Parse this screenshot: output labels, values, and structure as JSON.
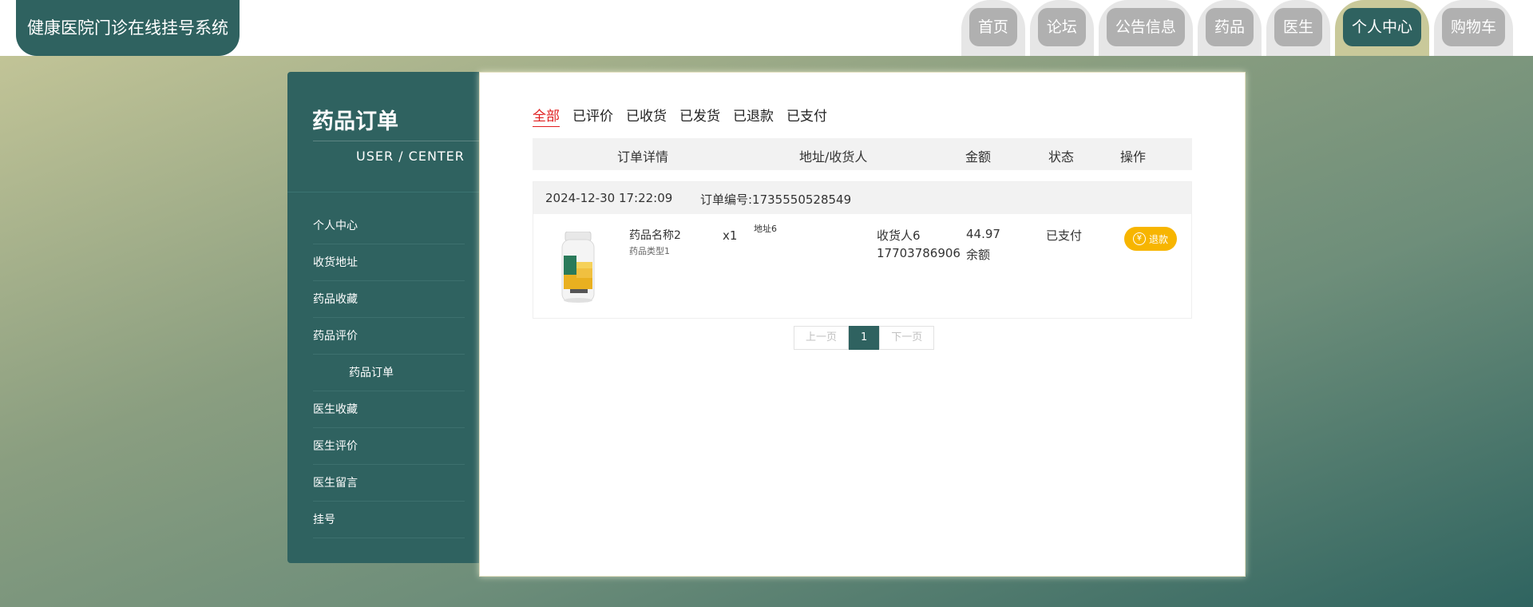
{
  "app": {
    "title": "健康医院门诊在线挂号系统"
  },
  "nav": {
    "items": [
      {
        "label": "首页"
      },
      {
        "label": "论坛"
      },
      {
        "label": "公告信息"
      },
      {
        "label": "药品"
      },
      {
        "label": "医生"
      },
      {
        "label": "个人中心",
        "active": true
      },
      {
        "label": "购物车"
      }
    ]
  },
  "sidebar": {
    "title": "药品订单",
    "subtitle": "USER / CENTER",
    "items": [
      {
        "label": "个人中心"
      },
      {
        "label": "收货地址"
      },
      {
        "label": "药品收藏"
      },
      {
        "label": "药品评价"
      },
      {
        "label": "药品订单",
        "active": true
      },
      {
        "label": "医生收藏"
      },
      {
        "label": "医生评价"
      },
      {
        "label": "医生留言"
      },
      {
        "label": "挂号"
      }
    ]
  },
  "filters": [
    "全部",
    "已评价",
    "已收货",
    "已发货",
    "已退款",
    "已支付"
  ],
  "table": {
    "headers": [
      "订单详情",
      "地址/收货人",
      "金额",
      "状态",
      "操作"
    ]
  },
  "order": {
    "time": "2024-12-30 17:22:09",
    "number_label": "订单编号:1735550528549",
    "product_name": "药品名称2",
    "product_type": "药品类型1",
    "quantity": "x1",
    "address": "地址6",
    "receiver": "收货人6",
    "phone": "17703786906",
    "amount": "44.97",
    "pay_method": "余额",
    "status": "已支付",
    "action_label": "退款",
    "action_icon": "yen-icon"
  },
  "pagination": {
    "prev": "上一页",
    "current": "1",
    "next": "下一页"
  },
  "colors": {
    "primary": "#2f6260",
    "accent": "#f7b500",
    "active_filter": "#e02020"
  }
}
